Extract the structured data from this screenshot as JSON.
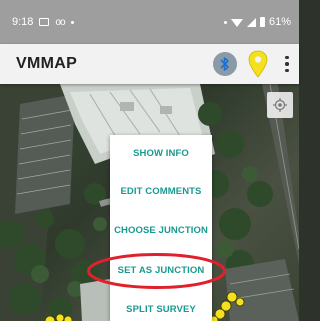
{
  "status_bar": {
    "time": "9:18",
    "voicemail_glyph": "oo",
    "battery_percent": "61%",
    "icons": [
      "image-notification-icon",
      "voicemail-icon",
      "wifi-icon",
      "signal-icon",
      "battery-icon"
    ]
  },
  "app_bar": {
    "title": "VMMAP",
    "icons": [
      "bluetooth-icon",
      "location-pin-icon",
      "overflow-menu-icon"
    ]
  },
  "map": {
    "locate_icon": "my-location-icon"
  },
  "context_menu": {
    "items": [
      {
        "label": "SHOW INFO"
      },
      {
        "label": "EDIT COMMENTS"
      },
      {
        "label": "CHOOSE JUNCTION"
      },
      {
        "label": "SET AS JUNCTION",
        "highlighted": true
      },
      {
        "label": "SPLIT SURVEY"
      }
    ]
  },
  "colors": {
    "menu_text": "#1a9a8e",
    "highlight_circle": "#e0202a",
    "marker": "#f5e020",
    "app_bar_bg": "#f2f2f2",
    "status_bar_bg": "#9e9e9e"
  }
}
